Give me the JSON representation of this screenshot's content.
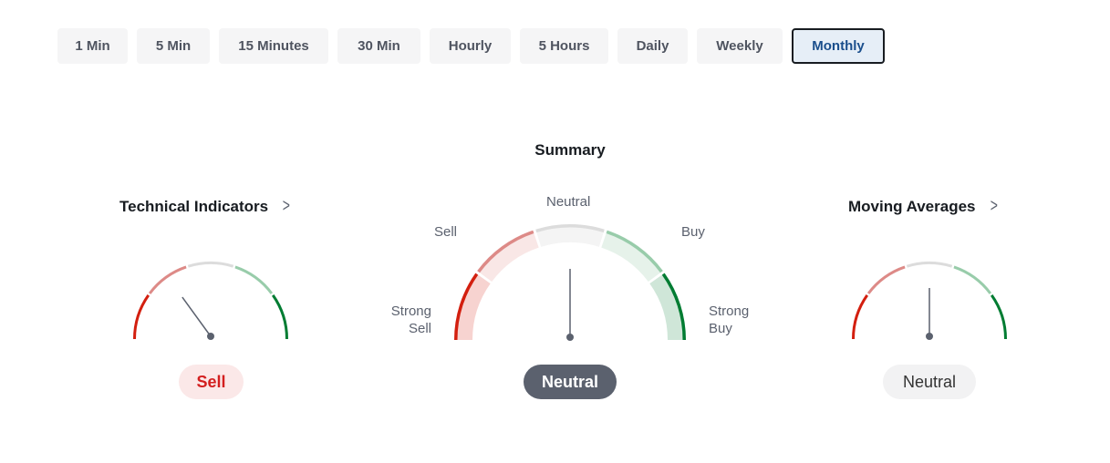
{
  "timeframes": {
    "items": [
      {
        "label": "1 Min",
        "active": false
      },
      {
        "label": "5 Min",
        "active": false
      },
      {
        "label": "15 Minutes",
        "active": false
      },
      {
        "label": "30 Min",
        "active": false
      },
      {
        "label": "Hourly",
        "active": false
      },
      {
        "label": "5 Hours",
        "active": false
      },
      {
        "label": "Daily",
        "active": false
      },
      {
        "label": "Weekly",
        "active": false
      },
      {
        "label": "Monthly",
        "active": true
      }
    ]
  },
  "technical_indicators": {
    "title": "Technical Indicators",
    "chevron_icon": "chevron-right-icon",
    "result": "Sell",
    "needle_fraction": 0.3
  },
  "summary": {
    "title": "Summary",
    "zones": {
      "strong_sell_line1": "Strong",
      "strong_sell_line2": "Sell",
      "sell": "Sell",
      "neutral": "Neutral",
      "buy": "Buy",
      "strong_buy_line1": "Strong",
      "strong_buy_line2": "Buy"
    },
    "result": "Neutral",
    "needle_fraction": 0.5
  },
  "moving_averages": {
    "title": "Moving Averages",
    "chevron_icon": "chevron-right-icon",
    "result": "Neutral",
    "needle_fraction": 0.5
  },
  "colors": {
    "strong_sell": "#d31f0f",
    "sell": "#dd8a87",
    "neutral": "#dcdcdc",
    "buy": "#98ccaa",
    "strong_buy": "#007c32",
    "strong_sell_fill": "#f7d3d0",
    "sell_fill": "#f9e7e6",
    "neutral_fill": "#f4f4f4",
    "buy_fill": "#e6f2ea",
    "strong_buy_fill": "#cfe6d8",
    "needle": "#5b616e"
  }
}
